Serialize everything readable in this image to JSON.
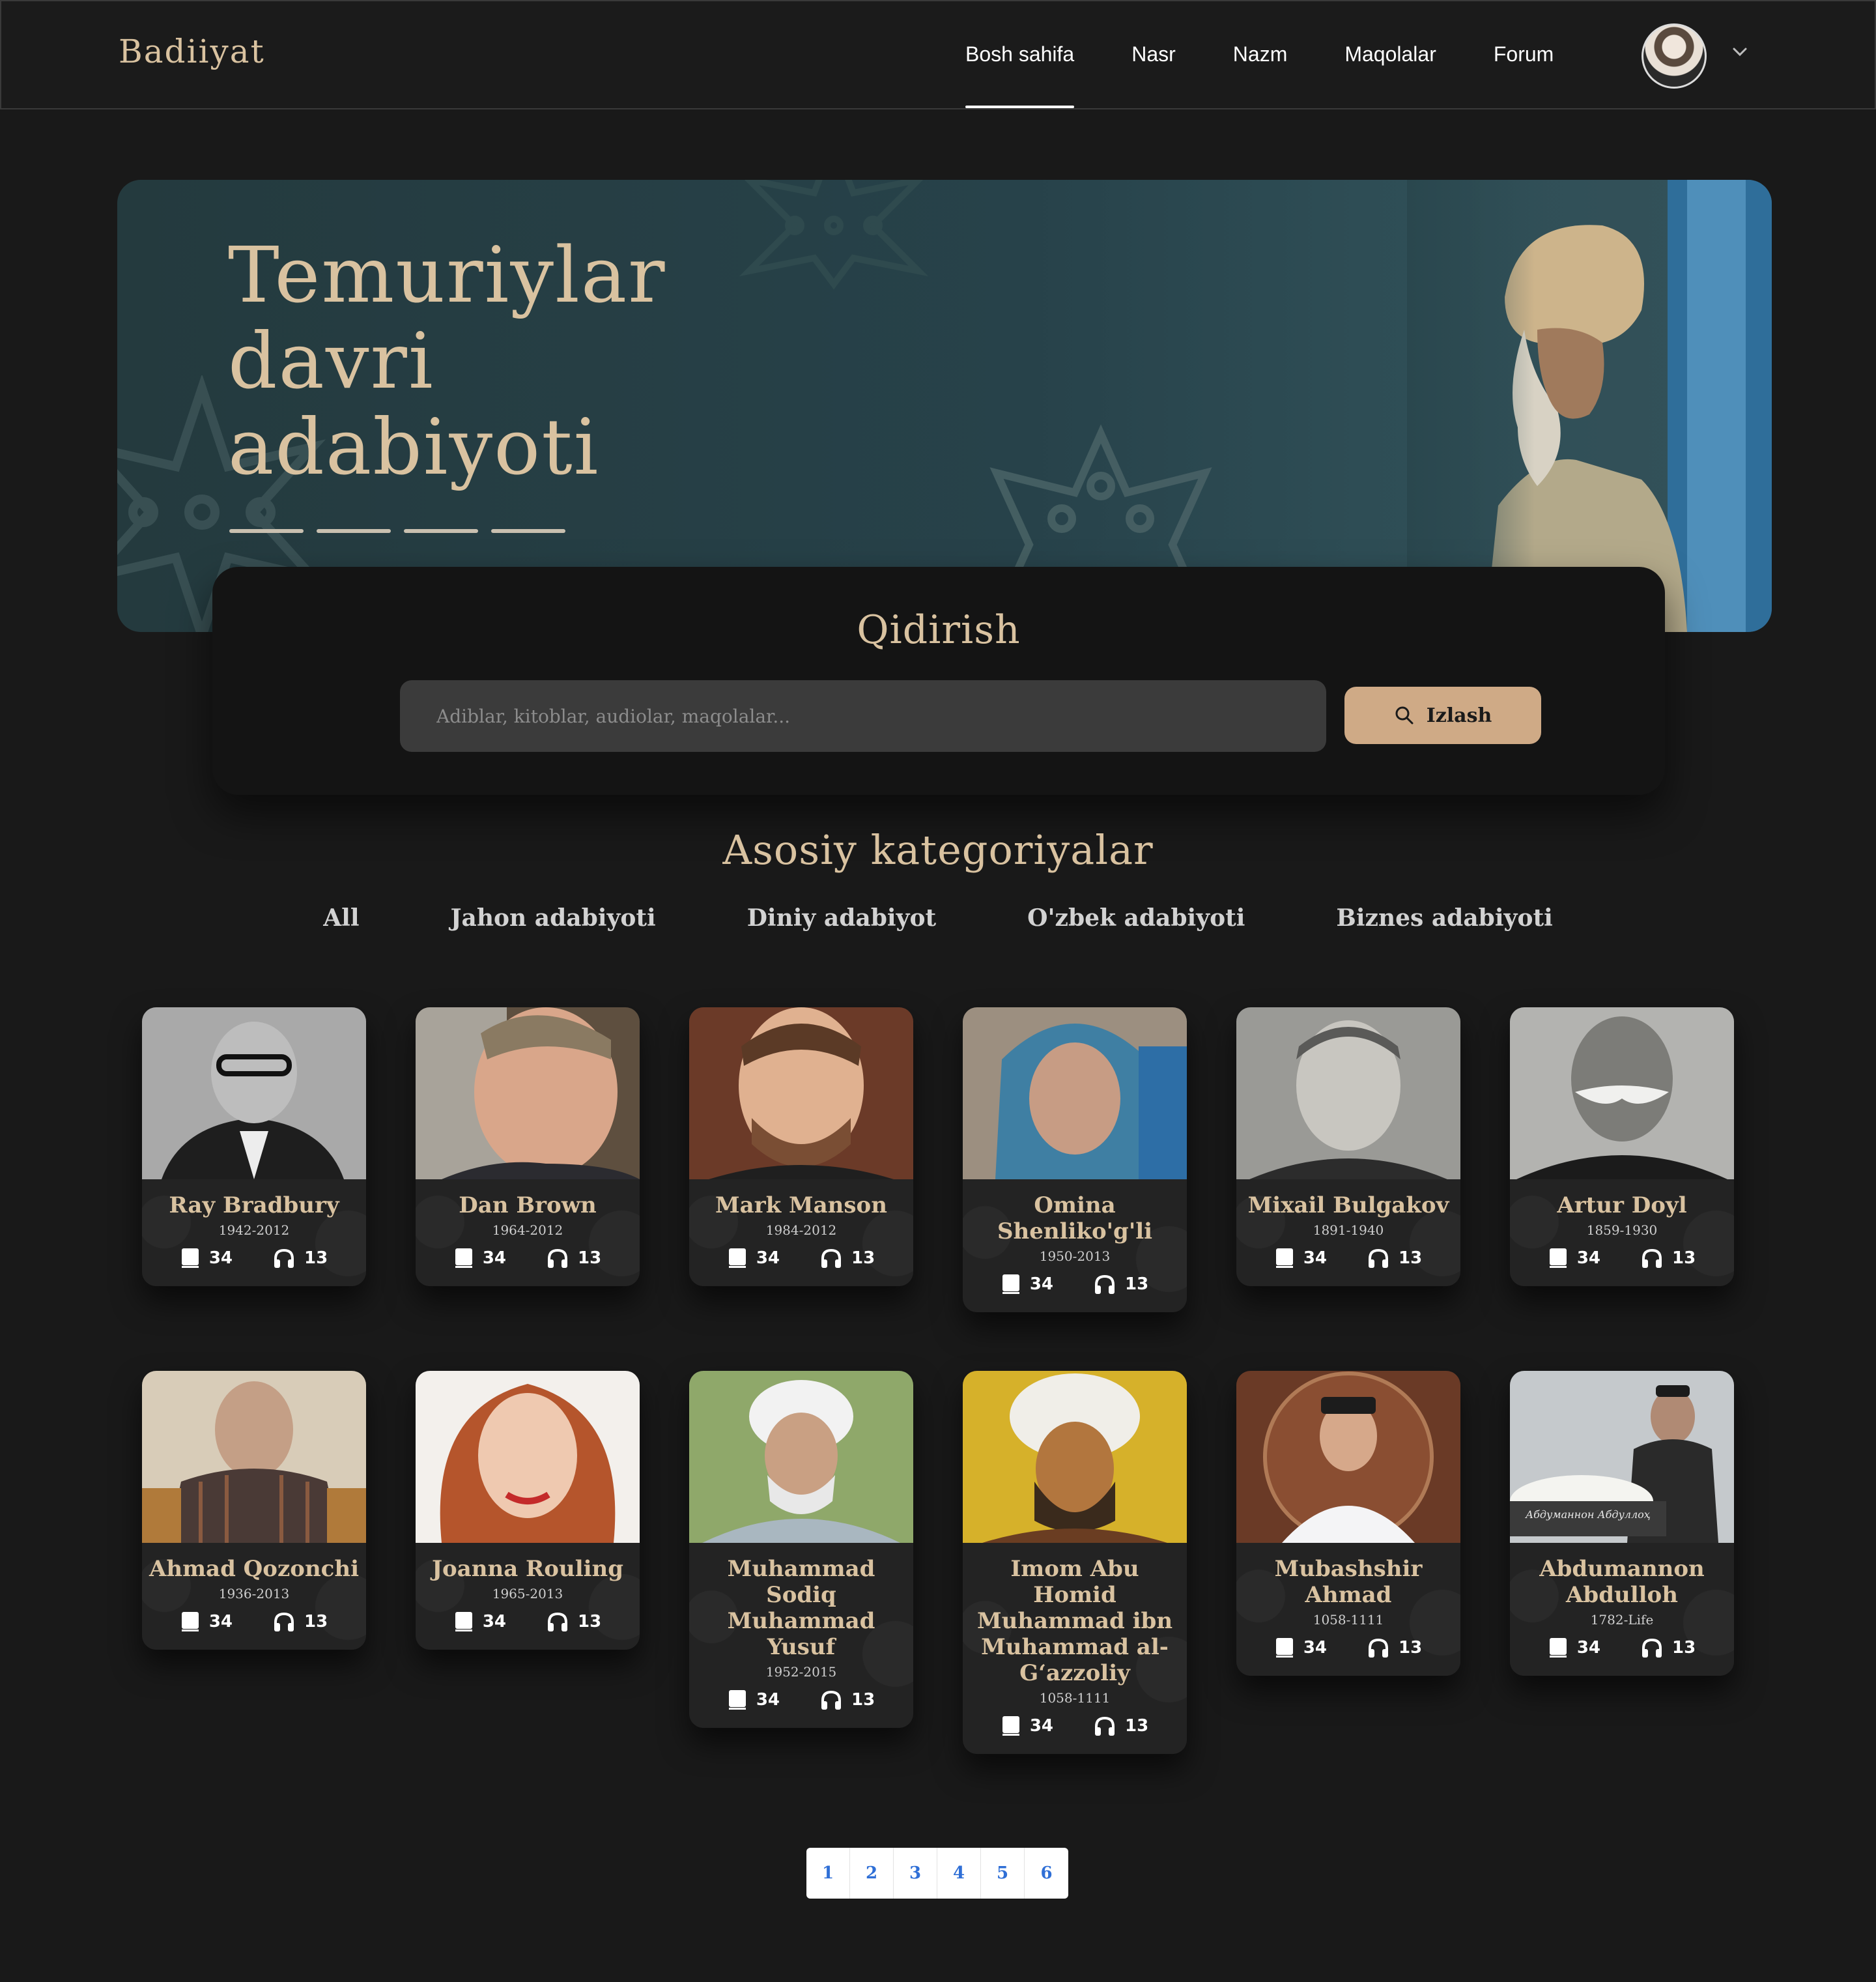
{
  "header": {
    "logo": "Badiiyat",
    "nav": [
      {
        "label": "Bosh sahifa",
        "active": true
      },
      {
        "label": "Nasr",
        "active": false
      },
      {
        "label": "Nazm",
        "active": false
      },
      {
        "label": "Maqolalar",
        "active": false
      },
      {
        "label": "Forum",
        "active": false
      }
    ],
    "user_menu_icon": "chevron-down-icon"
  },
  "hero": {
    "title_lines": [
      "Temuriylar",
      "davri",
      "adabiyoti"
    ],
    "slide_count": 4
  },
  "search": {
    "title": "Qidirish",
    "placeholder": "Adiblar, kitoblar, audiolar, maqolalar...",
    "button_label": "Izlash",
    "button_icon": "search-icon"
  },
  "categories": {
    "title": "Asosiy kategoriyalar",
    "tabs": [
      "All",
      "Jahon adabiyoti",
      "Diniy adabiyot",
      "O'zbek adabiyoti",
      "Biznes adabiyoti"
    ]
  },
  "authors": [
    {
      "name": "Ray Bradbury",
      "years": "1942-2012",
      "books": "34",
      "audio": "13"
    },
    {
      "name": "Dan Brown",
      "years": "1964-2012",
      "books": "34",
      "audio": "13"
    },
    {
      "name": "Mark Manson",
      "years": "1984-2012",
      "books": "34",
      "audio": "13"
    },
    {
      "name": "Omina Shenliko'g'li",
      "years": "1950-2013",
      "books": "34",
      "audio": "13"
    },
    {
      "name": "Mixail Bulgakov",
      "years": "1891-1940",
      "books": "34",
      "audio": "13"
    },
    {
      "name": "Artur Doyl",
      "years": "1859-1930",
      "books": "34",
      "audio": "13"
    },
    {
      "name": "Ahmad Qozonchi",
      "years": "1936-2013",
      "books": "34",
      "audio": "13"
    },
    {
      "name": "Joanna Rouling",
      "years": "1965-2013",
      "books": "34",
      "audio": "13"
    },
    {
      "name": "Muhammad Sodiq Muhammad Yusuf",
      "years": "1952-2015",
      "books": "34",
      "audio": "13"
    },
    {
      "name": "Imom Abu Homid Muhammad ibn Muhammad al-G‘azzoliy",
      "years": "1058-1111",
      "books": "34",
      "audio": "13"
    },
    {
      "name": "Mubashshir Ahmad",
      "years": "1058-1111",
      "books": "34",
      "audio": "13"
    },
    {
      "name": "Abdumannon Abdulloh",
      "years": "1782-Life",
      "books": "34",
      "audio": "13",
      "photo_caption": "Абдуманнон Абдуллоҳ"
    }
  ],
  "pagination": [
    "1",
    "2",
    "3",
    "4",
    "5",
    "6"
  ],
  "colors": {
    "background": "#191919",
    "accent": "#d9c2a0",
    "button": "#cfaa86",
    "hero": "#27424a",
    "card": "#232323",
    "link": "#2f6fd6"
  }
}
